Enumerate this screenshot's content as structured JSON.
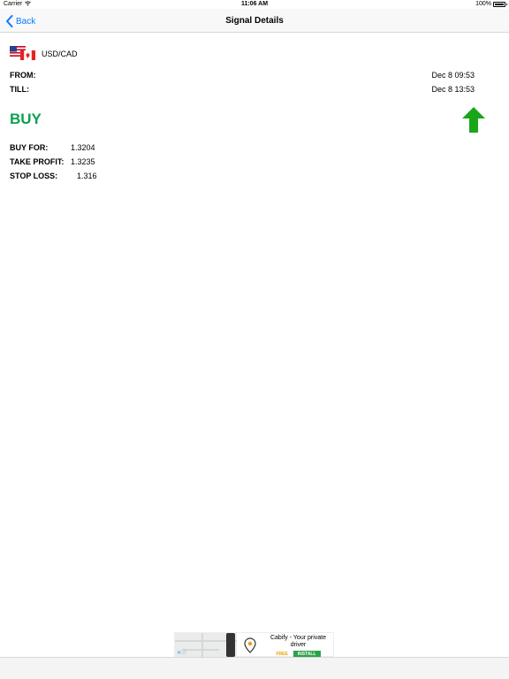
{
  "status_bar": {
    "carrier": "Carrier",
    "time": "11:06 AM",
    "battery_percent": "100%"
  },
  "nav": {
    "back_label": "Back",
    "title": "Signal Details"
  },
  "signal": {
    "pair": "USD/CAD",
    "from_label": "FROM:",
    "from_value": "Dec 8 09:53",
    "till_label": "TILL:",
    "till_value": "Dec 8 13:53",
    "direction": "BUY",
    "direction_icon": "up-arrow-icon",
    "levels": [
      {
        "label": "BUY FOR:",
        "value": "1.3204"
      },
      {
        "label": "TAKE PROFIT:",
        "value": "1.3235"
      },
      {
        "label": "STOP LOSS:",
        "value": "1.316"
      }
    ]
  },
  "ad": {
    "title": "Cabify - Your private driver",
    "free_label": "FREE",
    "install_label": "INSTALL"
  },
  "colors": {
    "accent": "#0a7aff",
    "buy": "#0aa052",
    "arrow": "#19a619"
  }
}
